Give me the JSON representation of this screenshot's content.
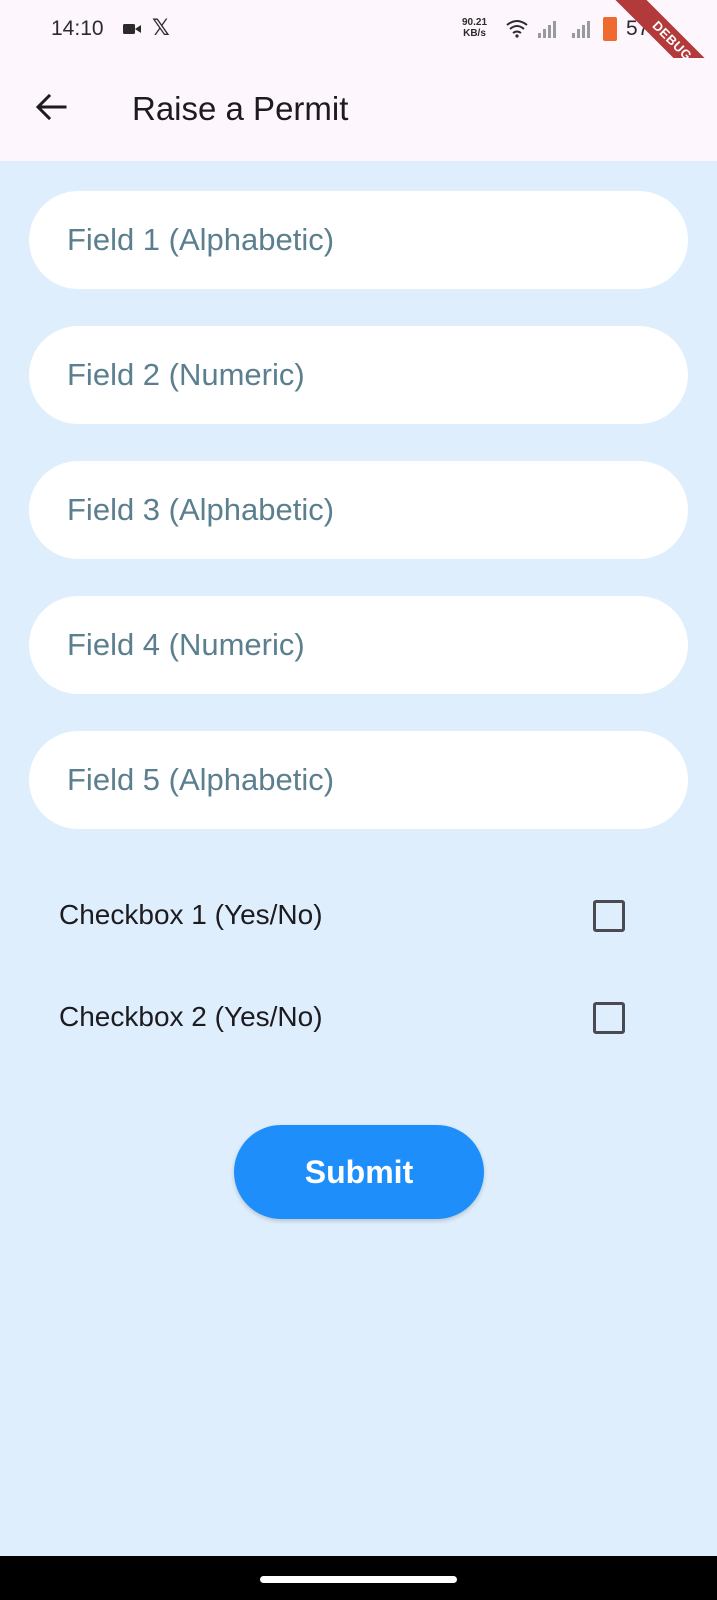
{
  "status_bar": {
    "time": "14:10",
    "network_speed_value": "90.21",
    "network_speed_unit": "KB/s",
    "battery_level": "57",
    "icons": [
      "camera-recording-icon",
      "x-app-icon",
      "wifi-icon",
      "signal-icon",
      "signal-icon",
      "battery-icon"
    ]
  },
  "debug_banner": "DEBUG",
  "app_bar": {
    "title": "Raise a Permit",
    "back_icon": "arrow-left-icon"
  },
  "form": {
    "fields": [
      {
        "placeholder": "Field 1 (Alphabetic)",
        "value": ""
      },
      {
        "placeholder": "Field 2 (Numeric)",
        "value": ""
      },
      {
        "placeholder": "Field 3 (Alphabetic)",
        "value": ""
      },
      {
        "placeholder": "Field 4 (Numeric)",
        "value": ""
      },
      {
        "placeholder": "Field 5 (Alphabetic)",
        "value": ""
      }
    ],
    "checkboxes": [
      {
        "label": "Checkbox 1 (Yes/No)",
        "checked": false
      },
      {
        "label": "Checkbox 2 (Yes/No)",
        "checked": false
      }
    ],
    "submit_label": "Submit"
  },
  "colors": {
    "background": "#deeefc",
    "app_bar": "#fdf6fd",
    "primary": "#1e8efb",
    "placeholder": "#5b7f8e",
    "debug_ribbon": "#b23a3a"
  }
}
